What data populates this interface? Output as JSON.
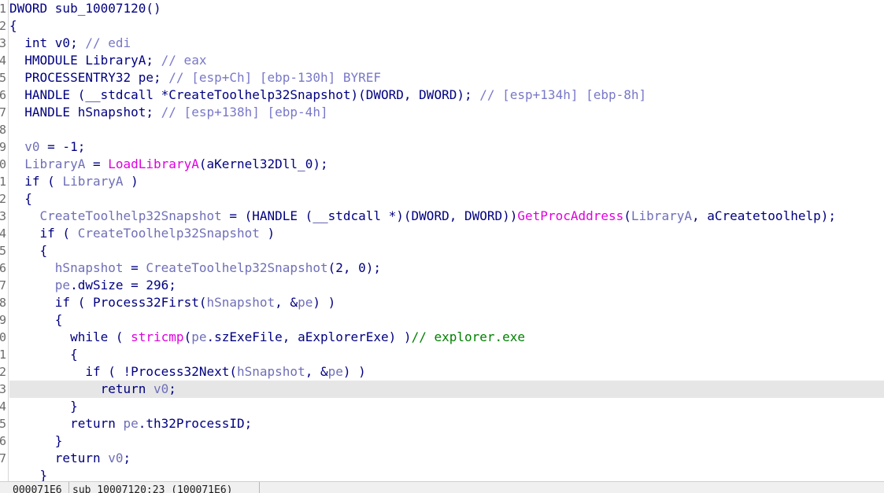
{
  "gutter": [
    "1",
    "2",
    "3",
    "4",
    "5",
    "6",
    "7",
    "8",
    "9",
    "0",
    "1",
    "2",
    "3",
    "4",
    "5",
    "6",
    "7",
    "8",
    "9",
    "0",
    "1",
    "2",
    "3",
    "4",
    "5",
    "6",
    "7"
  ],
  "highlighted_line": 23,
  "code_lines": [
    [
      [
        "fn",
        "DWORD sub_10007120()"
      ]
    ],
    [
      [
        "pun",
        "{"
      ]
    ],
    [
      [
        "kw",
        "  int v0; "
      ],
      [
        "cmt",
        "// edi"
      ]
    ],
    [
      [
        "kw",
        "  HMODULE LibraryA; "
      ],
      [
        "cmt",
        "// eax"
      ]
    ],
    [
      [
        "kw",
        "  PROCESSENTRY32 pe; "
      ],
      [
        "cmt",
        "// [esp+Ch] [ebp-130h] BYREF"
      ]
    ],
    [
      [
        "kw",
        "  HANDLE (__stdcall *CreateToolhelp32Snapshot)(DWORD, DWORD); "
      ],
      [
        "cmt",
        "// [esp+134h] [ebp-8h]"
      ]
    ],
    [
      [
        "kw",
        "  HANDLE hSnapshot; "
      ],
      [
        "cmt",
        "// [esp+138h] [ebp-4h]"
      ]
    ],
    [
      [
        "sp",
        ""
      ]
    ],
    [
      [
        "var",
        "  v0"
      ],
      [
        "pun",
        " = -1;"
      ]
    ],
    [
      [
        "var",
        "  LibraryA"
      ],
      [
        "pun",
        " = "
      ],
      [
        "imp",
        "LoadLibraryA"
      ],
      [
        "pun",
        "(aKernel32Dll_0);"
      ]
    ],
    [
      [
        "kw",
        "  if ( "
      ],
      [
        "var",
        "LibraryA"
      ],
      [
        "pun",
        " )"
      ]
    ],
    [
      [
        "pun",
        "  {"
      ]
    ],
    [
      [
        "var",
        "    CreateToolhelp32Snapshot"
      ],
      [
        "pun",
        " = (HANDLE (__stdcall *)(DWORD, DWORD))"
      ],
      [
        "imp",
        "GetProcAddress"
      ],
      [
        "pun",
        "("
      ],
      [
        "var",
        "LibraryA"
      ],
      [
        "pun",
        ", aCreatetoolhelp);"
      ]
    ],
    [
      [
        "kw",
        "    if ( "
      ],
      [
        "var",
        "CreateToolhelp32Snapshot"
      ],
      [
        "pun",
        " )"
      ]
    ],
    [
      [
        "pun",
        "    {"
      ]
    ],
    [
      [
        "var",
        "      hSnapshot"
      ],
      [
        "pun",
        " = "
      ],
      [
        "var",
        "CreateToolhelp32Snapshot"
      ],
      [
        "pun",
        "(2, 0);"
      ]
    ],
    [
      [
        "var",
        "      pe"
      ],
      [
        "pun",
        ".dwSize = 296;"
      ]
    ],
    [
      [
        "kw",
        "      if ( "
      ],
      [
        "fn",
        "Process32First"
      ],
      [
        "pun",
        "("
      ],
      [
        "var",
        "hSnapshot"
      ],
      [
        "pun",
        ", &"
      ],
      [
        "var",
        "pe"
      ],
      [
        "pun",
        ") )"
      ]
    ],
    [
      [
        "pun",
        "      {"
      ]
    ],
    [
      [
        "kw",
        "        while ( "
      ],
      [
        "imp",
        "stricmp"
      ],
      [
        "pun",
        "("
      ],
      [
        "var",
        "pe"
      ],
      [
        "pun",
        ".szExeFile, aExplorerExe) )"
      ],
      [
        "gcmt",
        "// explorer.exe"
      ]
    ],
    [
      [
        "pun",
        "        {"
      ]
    ],
    [
      [
        "kw",
        "          if ( !"
      ],
      [
        "fn",
        "Process32Next"
      ],
      [
        "pun",
        "("
      ],
      [
        "var",
        "hSnapshot"
      ],
      [
        "pun",
        ", &"
      ],
      [
        "var",
        "pe"
      ],
      [
        "pun",
        ") )"
      ]
    ],
    [
      [
        "kw",
        "            return "
      ],
      [
        "var",
        "v0"
      ],
      [
        "pun",
        ";"
      ]
    ],
    [
      [
        "pun",
        "        }"
      ]
    ],
    [
      [
        "kw",
        "        return "
      ],
      [
        "var",
        "pe"
      ],
      [
        "pun",
        ".th32ProcessID;"
      ]
    ],
    [
      [
        "pun",
        "      }"
      ]
    ],
    [
      [
        "kw",
        "      return "
      ],
      [
        "var",
        "v0"
      ],
      [
        "pun",
        ";"
      ]
    ],
    [
      [
        "pun",
        "    }"
      ]
    ]
  ],
  "status": {
    "address": "000071E6",
    "location": "sub_10007120:23 (100071E6)"
  }
}
